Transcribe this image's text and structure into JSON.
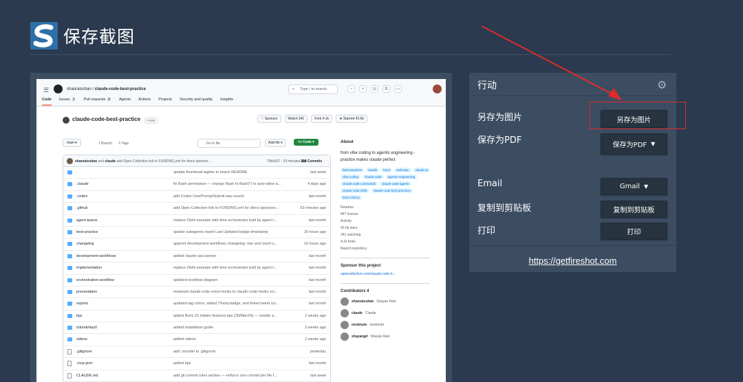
{
  "app": {
    "title": "保存截图"
  },
  "github": {
    "breadcrumb_owner": "shanraisshan",
    "breadcrumb_sep": "/",
    "breadcrumb_repo": "claude-code-best-practice",
    "search_placeholder": "Type / to search",
    "tabs": [
      {
        "label": "Code"
      },
      {
        "label": "Issues",
        "count": "3"
      },
      {
        "label": "Pull requests",
        "count": "8"
      },
      {
        "label": "Agents"
      },
      {
        "label": "Actions"
      },
      {
        "label": "Projects"
      },
      {
        "label": "Security and quality"
      },
      {
        "label": "Insights"
      }
    ],
    "repo_name": "claude-code-best-practice",
    "visibility": "Public",
    "sponsor": "♡ Sponsor",
    "watch": "Watch 341",
    "fork": "Fork 4.1k",
    "starred": "★ Starred 42.5k",
    "branch": "main ▾",
    "branches": "1 Branch",
    "tags": "0 Tags",
    "goto_file": "Go to file",
    "add_file": "Add file ▾",
    "code_btn": "<> Code ▾",
    "commit_author": "shanraisshan",
    "commit_and": "and",
    "commit_coauthor": "claude",
    "commit_msg": "add Open Collective link to FUNDING.yml for direct sponsor...",
    "commit_hash": "79b5d27 · 53 minutes ago",
    "commit_count": "358 Commits",
    "files": [
      {
        "name": ".",
        "msg": "update thumbnail tagline to match README",
        "date": "last week",
        "type": "dir"
      },
      {
        "name": ".claude",
        "msg": "fix Bash permission — change Bash to Bash(*) to auto-allow a...",
        "date": "4 days ago",
        "type": "dir"
      },
      {
        "name": ".codex",
        "msg": "add Codex UserPromptSubmit wav sound",
        "date": "last month",
        "type": "dir"
      },
      {
        "name": ".github",
        "msg": "add Open Collective link to FUNDING.yml for direct sponsors...",
        "date": "53 minutes ago",
        "type": "dir"
      },
      {
        "name": "agent-teams",
        "msg": "replace Oishi example with time orchestrator built by agent t...",
        "date": "last month",
        "type": "dir"
      },
      {
        "name": "best-practice",
        "msg": "update subagents report Last Updated badge timestamp",
        "date": "16 hours ago",
        "type": "dir"
      },
      {
        "name": "changelog",
        "msg": "append development workflows changelog: star and count u...",
        "date": "16 hours ago",
        "type": "dir"
      },
      {
        "name": "development-workflows",
        "msg": "added claude-usa banner",
        "date": "last month",
        "type": "dir"
      },
      {
        "name": "implementation",
        "msg": "replace Oishi example with time orchestrator built by agent t...",
        "date": "last month",
        "type": "dir"
      },
      {
        "name": "orchestration-workflow",
        "msg": "updated workflow diagram",
        "date": "last month",
        "type": "dir"
      },
      {
        "name": "presentation",
        "msg": "renamed claude-code-voice-hooks to claude-code-hooks scr...",
        "date": "last month",
        "type": "dir"
      },
      {
        "name": "reports",
        "msg": "updated tag colors, added Thariq badge, and linked tweet scr...",
        "date": "last month",
        "type": "dir"
      },
      {
        "name": "tips",
        "msg": "added Boris 15 hidden features tips (30/Mar/26) — mobile a...",
        "date": "2 weeks ago",
        "type": "dir"
      },
      {
        "name": "tutorial/day0",
        "msg": "added installation guide",
        "date": "3 weeks ago",
        "type": "dir"
      },
      {
        "name": "videos",
        "msg": "added videos",
        "date": "2 weeks ago",
        "type": "dir"
      },
      {
        "name": ".gitignore",
        "msg": "add .vscode/ to .gitignore",
        "date": "yesterday",
        "type": "file"
      },
      {
        "name": ".mcp.json",
        "msg": "added tips",
        "date": "last month",
        "type": "file"
      },
      {
        "name": "CLAUDE.md",
        "msg": "add git commit rules section — enforce one commit per file f...",
        "date": "last week",
        "type": "file"
      }
    ],
    "about_title": "About",
    "about_desc": "from vibe coding to agentic engineering - practice makes claude perfect",
    "topics": [
      "best-practices",
      "claude",
      "boris",
      "anthropic",
      "claude-ai",
      "vibe-coding",
      "claude-code",
      "agentic-engineering",
      "claude-code-commands",
      "claude-code-agents",
      "claude-code-skills",
      "claude-code-best-practices",
      "boris-cherny"
    ],
    "links": [
      "Readme",
      "MIT license",
      "Activity",
      "42.5k stars",
      "341 watching",
      "4.1k forks",
      "Report repository"
    ],
    "sponsor_title": "Sponsor this project",
    "sponsor_link": "opencollective.com/claude-code-b...",
    "contributors_title": "Contributors",
    "contributors_count": "4",
    "contributors": [
      {
        "login": "shanraisshan",
        "name": "Shayan Rais"
      },
      {
        "login": "claude",
        "name": "Claude"
      },
      {
        "login": "neutmute",
        "name": "neutmute"
      },
      {
        "login": "shayangd",
        "name": "Shayan Rais"
      }
    ]
  },
  "panel": {
    "title": "行动",
    "labels": {
      "save_image": "另存为图片",
      "save_pdf": "保存为PDF",
      "email": "Email",
      "copy": "复制到剪贴板",
      "print": "打印"
    },
    "buttons": {
      "save_image": "另存为图片",
      "save_pdf": "保存为PDF",
      "gmail": "Gmail",
      "copy": "复制到剪贴板",
      "print": "打印"
    },
    "footer_link": "https://getfireshot.com"
  },
  "colors": {
    "background": "#2b3a4e",
    "panel": "#3c4d62",
    "button": "#27343f",
    "highlight": "#e02b2b",
    "github_green": "#1f883d"
  }
}
